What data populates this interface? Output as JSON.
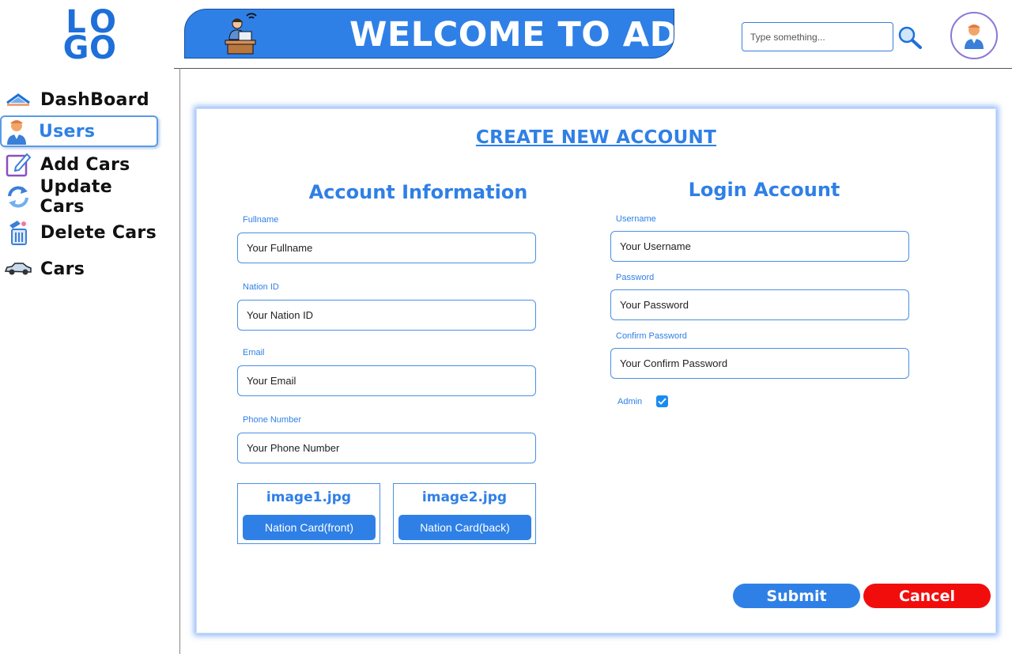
{
  "logo": {
    "letters": [
      "L",
      "O",
      "G",
      "O"
    ]
  },
  "header": {
    "title": "WELCOME TO ADMIN"
  },
  "search": {
    "placeholder": "Type something..."
  },
  "sidebar": {
    "items": [
      {
        "label": "DashBoard",
        "icon": "dashboard-icon"
      },
      {
        "label": "Users",
        "icon": "user-icon",
        "active": true
      },
      {
        "label": "Add Cars",
        "icon": "edit-icon"
      },
      {
        "label": "Update Cars",
        "icon": "refresh-icon"
      },
      {
        "label": "Delete Cars",
        "icon": "trash-icon"
      },
      {
        "label": "Cars",
        "icon": "car-icon"
      }
    ]
  },
  "form": {
    "title": "CREATE NEW ACCOUNT",
    "account_info": {
      "title": "Account Information",
      "fullname": {
        "label": "Fullname",
        "placeholder": "Your Fullname"
      },
      "nation_id": {
        "label": "Nation ID",
        "placeholder": "Your Nation ID"
      },
      "email": {
        "label": "Email",
        "placeholder": "Your Email"
      },
      "phone": {
        "label": "Phone Number",
        "placeholder": "Your Phone Number"
      },
      "image1": {
        "name": "image1.jpg",
        "button": "Nation Card(front)"
      },
      "image2": {
        "name": "image2.jpg",
        "button": "Nation Card(back)"
      }
    },
    "login": {
      "title": "Login Account",
      "username": {
        "label": "Username",
        "placeholder": "Your Username"
      },
      "password": {
        "label": "Password",
        "placeholder": "Your Password"
      },
      "confirm": {
        "label": "Confirm Password",
        "placeholder": "Your Confirm Password"
      },
      "admin": {
        "label": "Admin",
        "checked": true
      }
    },
    "submit_label": "Submit",
    "cancel_label": "Cancel"
  },
  "colors": {
    "accent": "#2f80e6",
    "danger": "#f20d0d"
  }
}
